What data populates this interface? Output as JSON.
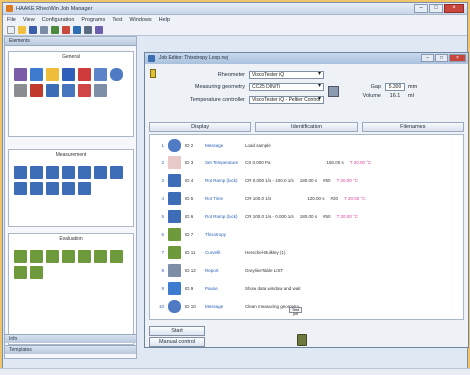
{
  "app": {
    "title": "HAAKE RheoWin Job Manager"
  },
  "menu": [
    "File",
    "View",
    "Configuration",
    "Programs",
    "Test",
    "Windows",
    "Help"
  ],
  "left": {
    "header": "Elements",
    "groups": [
      {
        "title": "General"
      },
      {
        "title": "Measurement"
      },
      {
        "title": "Evaluation"
      }
    ],
    "footer_info": "Info",
    "footer_templates": "Templates"
  },
  "editor": {
    "title": "Job Editor: Thixotropy Loop.rwj",
    "rheometer_label": "Rheometer",
    "rheometer_value": "ViscoTester iQ",
    "geometry_label": "Measuring geometry",
    "geometry_value": "CC25 DIN/Ti",
    "temp_label": "Temperature controller",
    "temp_value": "ViscoTester iQ - Peltier Control",
    "gap_label": "Gap",
    "gap_value": "5.300",
    "gap_unit": "mm",
    "volume_label": "Volume",
    "volume_value": "16.1",
    "volume_unit": "ml",
    "tabs": [
      "Display",
      "Identification",
      "Filenames"
    ],
    "rows": [
      {
        "n": "1",
        "code": "ID 2",
        "cmd": "Message",
        "detail": [
          "Load sample"
        ]
      },
      {
        "n": "2",
        "code": "ID 3",
        "cmd": "Set Temperature",
        "detail": [
          "CS  0.000 Pa",
          "150.00 s",
          "T 20.00 °C"
        ]
      },
      {
        "n": "3",
        "code": "ID 4",
        "cmd": "Rot Ramp (lock)",
        "detail": [
          "CR  0.000 1/s - 100.0 1/s",
          "180.00 s",
          "#50",
          "T 20.00 °C"
        ]
      },
      {
        "n": "4",
        "code": "ID 5",
        "cmd": "Rot Time",
        "detail": [
          "CR  100.0 1/s",
          "120.00 s",
          "#20",
          "T 20.00 °C"
        ]
      },
      {
        "n": "5",
        "code": "ID 6",
        "cmd": "Rot Ramp (lock)",
        "detail": [
          "CR  100.0 1/s - 0.000 1/s",
          "180.00 s",
          "#50",
          "T 20.00 °C"
        ]
      },
      {
        "n": "6",
        "code": "ID 7",
        "cmd": "Thixotropy",
        "detail": []
      },
      {
        "n": "7",
        "code": "ID 11",
        "cmd": "Curvefit",
        "detail": [
          "Herschel-Bulkley (1)"
        ]
      },
      {
        "n": "8",
        "code": "ID 12",
        "cmd": "Report",
        "detail": [
          "GreylineTable LIST"
        ]
      },
      {
        "n": "9",
        "code": "ID 9",
        "cmd": "Pause",
        "detail": [
          "Show data window and wait"
        ]
      },
      {
        "n": "10",
        "code": "ID 10",
        "cmd": "Message",
        "detail": [
          "Clean measuring geometry"
        ]
      }
    ],
    "small_btn": "Test job",
    "start_btn": "Start",
    "manual_btn": "Manual control"
  }
}
